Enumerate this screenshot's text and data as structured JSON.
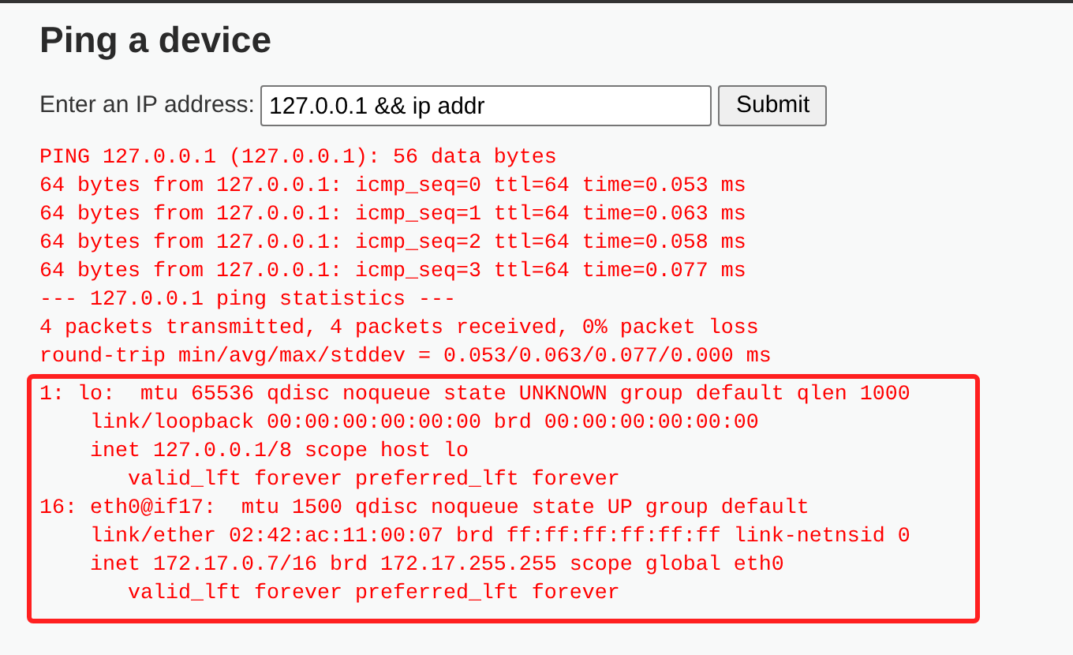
{
  "heading": "Ping a device",
  "form": {
    "label": "Enter an IP address:",
    "value": "127.0.0.1 && ip addr",
    "button": "Submit"
  },
  "output": {
    "lines": [
      "PING 127.0.0.1 (127.0.0.1): 56 data bytes",
      "64 bytes from 127.0.0.1: icmp_seq=0 ttl=64 time=0.053 ms",
      "64 bytes from 127.0.0.1: icmp_seq=1 ttl=64 time=0.063 ms",
      "64 bytes from 127.0.0.1: icmp_seq=2 ttl=64 time=0.058 ms",
      "64 bytes from 127.0.0.1: icmp_seq=3 ttl=64 time=0.077 ms",
      "--- 127.0.0.1 ping statistics ---",
      "4 packets transmitted, 4 packets received, 0% packet loss",
      "round-trip min/avg/max/stddev = 0.053/0.063/0.077/0.000 ms"
    ],
    "highlighted_lines": [
      "1: lo:  mtu 65536 qdisc noqueue state UNKNOWN group default qlen 1000",
      "    link/loopback 00:00:00:00:00:00 brd 00:00:00:00:00:00",
      "    inet 127.0.0.1/8 scope host lo",
      "       valid_lft forever preferred_lft forever",
      "16: eth0@if17:  mtu 1500 qdisc noqueue state UP group default",
      "    link/ether 02:42:ac:11:00:07 brd ff:ff:ff:ff:ff:ff link-netnsid 0",
      "    inet 172.17.0.7/16 brd 172.17.255.255 scope global eth0",
      "       valid_lft forever preferred_lft forever"
    ]
  }
}
